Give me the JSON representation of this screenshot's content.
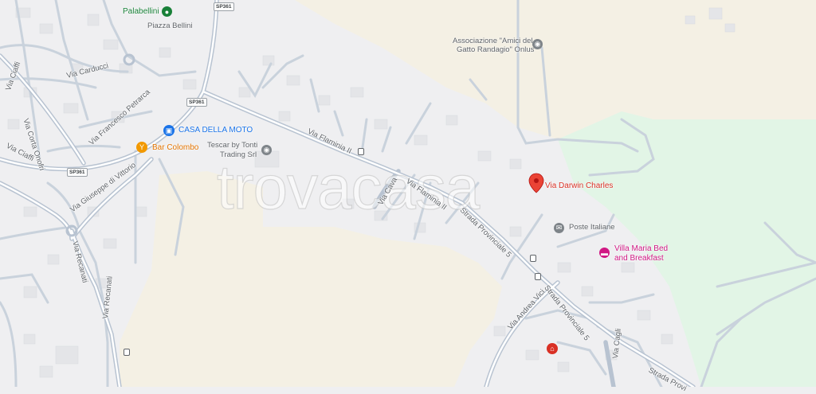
{
  "map": {
    "watermark": "trovacasa",
    "colors": {
      "urban": "#efeff1",
      "fields": "#f4f0e4",
      "park": "#e2f5e6",
      "roads": "#c5d0dc",
      "buildings": "#e6e7ea",
      "marker": "#ea4335"
    },
    "marker": {
      "label": "Via Darwin Charles",
      "icon": "location-pin-icon"
    },
    "pois": [
      {
        "label": "Palabellini",
        "icon": "stadium-icon",
        "color": "#188038"
      },
      {
        "label": "Piazza Bellini"
      },
      {
        "label": "Associazione \"Amici del",
        "label2": "Gatto Randagio\" Onlus",
        "icon": "place-icon"
      },
      {
        "label": "CASA DELLA MOTO",
        "icon": "shopping-bag-icon",
        "color": "#1a73e8"
      },
      {
        "label": "Bar Colombo",
        "icon": "cocktail-icon",
        "color": "#e37400"
      },
      {
        "label": "Tescar by Tonti",
        "label2": "Trading Srl",
        "icon": "place-icon"
      },
      {
        "label": "Poste Italiane",
        "icon": "mail-icon"
      },
      {
        "label": "Villa Maria Bed",
        "label2": "and Breakfast",
        "icon": "bed-icon",
        "color": "#d01884"
      },
      {
        "label": "",
        "icon": "museum-icon",
        "color": "#d93025"
      }
    ],
    "shields": [
      "SP361",
      "SP361",
      "SP361"
    ],
    "roads": [
      "Via Carducci",
      "Via Francesco Petrarca",
      "Via Corta Onofri",
      "Via Ciaffi",
      "Via Giuseppe di Vittorio",
      "Via Recanati",
      "Via Flaminia II",
      "Via Flaminia II",
      "Via Cava",
      "Strada Provinciale 5",
      "Strada Provinciale 5",
      "Via Andrea Vici",
      "Via Cagli",
      "Strada Provi",
      "Via Ciaffi",
      "Via Recanati"
    ]
  }
}
